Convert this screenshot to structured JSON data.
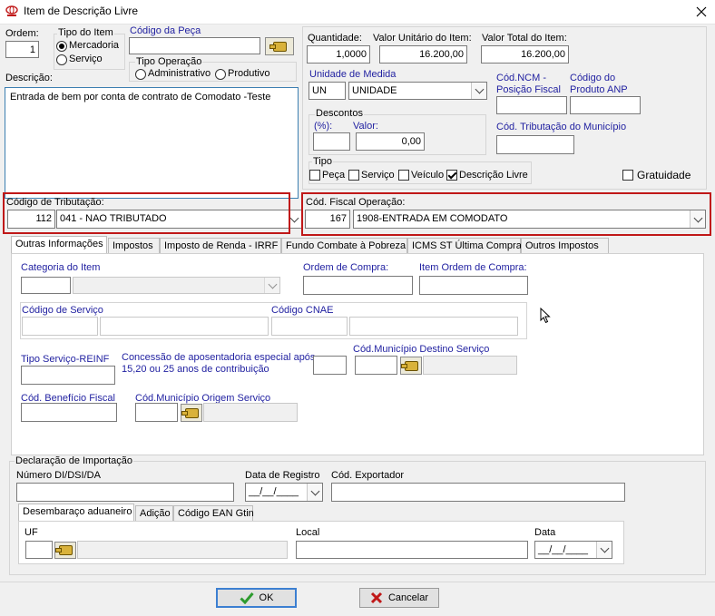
{
  "window": {
    "title": "Item de Descrição Livre"
  },
  "ordem": {
    "label": "Ordem:",
    "value": "1"
  },
  "tipo_item": {
    "label": "Tipo do Item",
    "options": [
      "Mercadoria",
      "Serviço"
    ],
    "selected": "Mercadoria"
  },
  "codigo_peca": {
    "label": "Código da Peça",
    "value": ""
  },
  "tipo_operacao": {
    "label": "Tipo Operação",
    "options": [
      "Administrativo",
      "Produtivo"
    ],
    "selected": ""
  },
  "descricao": {
    "label": "Descrição:",
    "value": "Entrada de bem por conta de contrato de Comodato -Teste"
  },
  "quantidade": {
    "label": "Quantidade:",
    "value": "1,0000"
  },
  "valor_unitario": {
    "label": "Valor Unitário do Item:",
    "value": "16.200,00"
  },
  "valor_total": {
    "label": "Valor Total do Item:",
    "value": "16.200,00"
  },
  "unidade": {
    "label": "Unidade de Medida",
    "code": "UN",
    "name": "UNIDADE"
  },
  "cod_ncm": {
    "label_1": "Cód.NCM -",
    "label_2": "Posição Fiscal",
    "value": ""
  },
  "cod_anp": {
    "label_1": "Código do",
    "label_2": "Produto ANP",
    "value": ""
  },
  "descontos": {
    "label": "Descontos",
    "pct_label": "(%):",
    "valor_label": "Valor:",
    "pct": "",
    "valor": "0,00"
  },
  "cod_trib_municipio": {
    "label": "Cód. Tributação do Município",
    "value": ""
  },
  "tipo": {
    "label": "Tipo",
    "options": [
      {
        "label": "Peça",
        "checked": false
      },
      {
        "label": "Serviço",
        "checked": false
      },
      {
        "label": "Veículo",
        "checked": false
      },
      {
        "label": "Descrição Livre",
        "checked": true
      }
    ]
  },
  "gratuidade": {
    "label": "Gratuidade",
    "checked": false
  },
  "codigo_tributacao": {
    "label": "Código de Tributação:",
    "code": "112",
    "name": "041 - NAO TRIBUTADO"
  },
  "cod_fiscal": {
    "label": "Cód. Fiscal Operação:",
    "code": "167",
    "name": "1908-ENTRADA EM COMODATO"
  },
  "tabs": [
    "Outras Informações",
    "Impostos",
    "Imposto de Renda - IRRF",
    "Fundo Combate à Pobreza",
    "ICMS ST Última Compra",
    "Outros Impostos"
  ],
  "outras": {
    "categoria_label": "Categoria do Item",
    "ordem_compra_label": "Ordem de Compra:",
    "item_ordem_label": "Item Ordem de Compra:",
    "codigo_servico_label": "Código de Serviço",
    "codigo_cnae_label": "Código CNAE",
    "tipo_servico_label": "Tipo Serviço-REINF",
    "concessao_line1": "Concessão de aposentadoria especial após",
    "concessao_line2": "15,20 ou 25 anos de contribuição",
    "mun_destino_label": "Cód.Município Destino Serviço",
    "beneficio_label": "Cód. Benefício Fiscal",
    "mun_origem_label": "Cód.Município Origem Serviço"
  },
  "importacao": {
    "label": "Declaração de Importação",
    "numero_label": "Número DI/DSI/DA",
    "data_registro_label": "Data de Registro",
    "data_placeholder": "__/__/____",
    "exportador_label": "Cód. Exportador",
    "subtabs": [
      "Desembaraço aduaneiro",
      "Adição",
      "Código EAN Gtin"
    ],
    "uf_label": "UF",
    "local_label": "Local",
    "data_label": "Data"
  },
  "buttons": {
    "ok": "OK",
    "cancel": "Cancelar"
  },
  "colors": {
    "highlight": "#c01818",
    "blue_label": "#1f1fa0",
    "ok_check": "#2e9b2e",
    "cancel_x": "#c01818"
  }
}
